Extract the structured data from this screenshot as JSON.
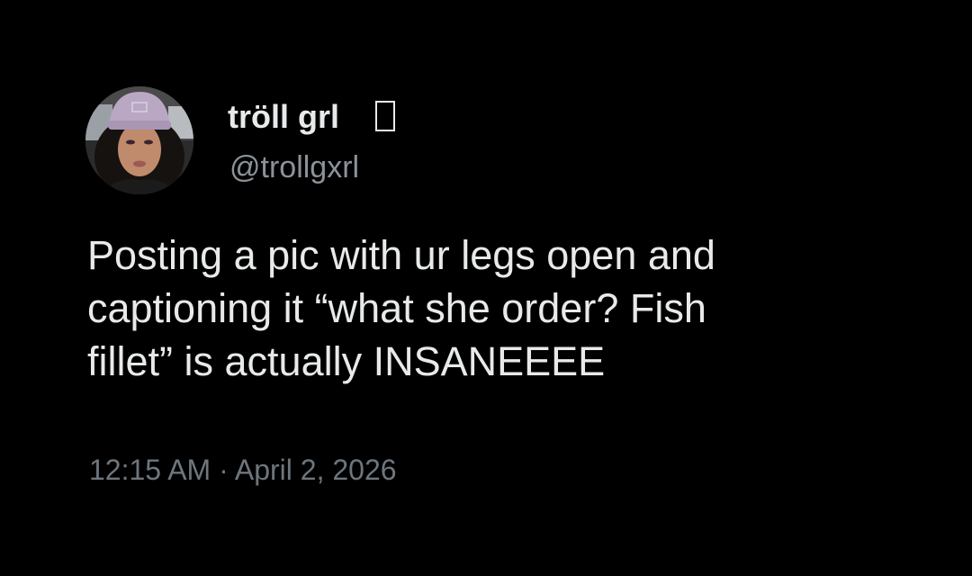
{
  "author": {
    "display_name": "tröll grl",
    "badge_icon": "missing-glyph-box-icon",
    "handle": "@trollgxrl",
    "avatar": "profile-photo-woman-lavender-beanie"
  },
  "tweet": {
    "text_lines": [
      "Posting a pic with ur legs open and",
      "captioning it “what she order? Fish",
      "fillet” is actually INSANEEEE"
    ],
    "time": "12:15 AM",
    "separator": "·",
    "date": "April 2, 2026"
  },
  "colors": {
    "background": "#000000",
    "primary_text": "#e7e9ea",
    "secondary_text": "#8b9299",
    "meta_text": "#6e767d"
  }
}
